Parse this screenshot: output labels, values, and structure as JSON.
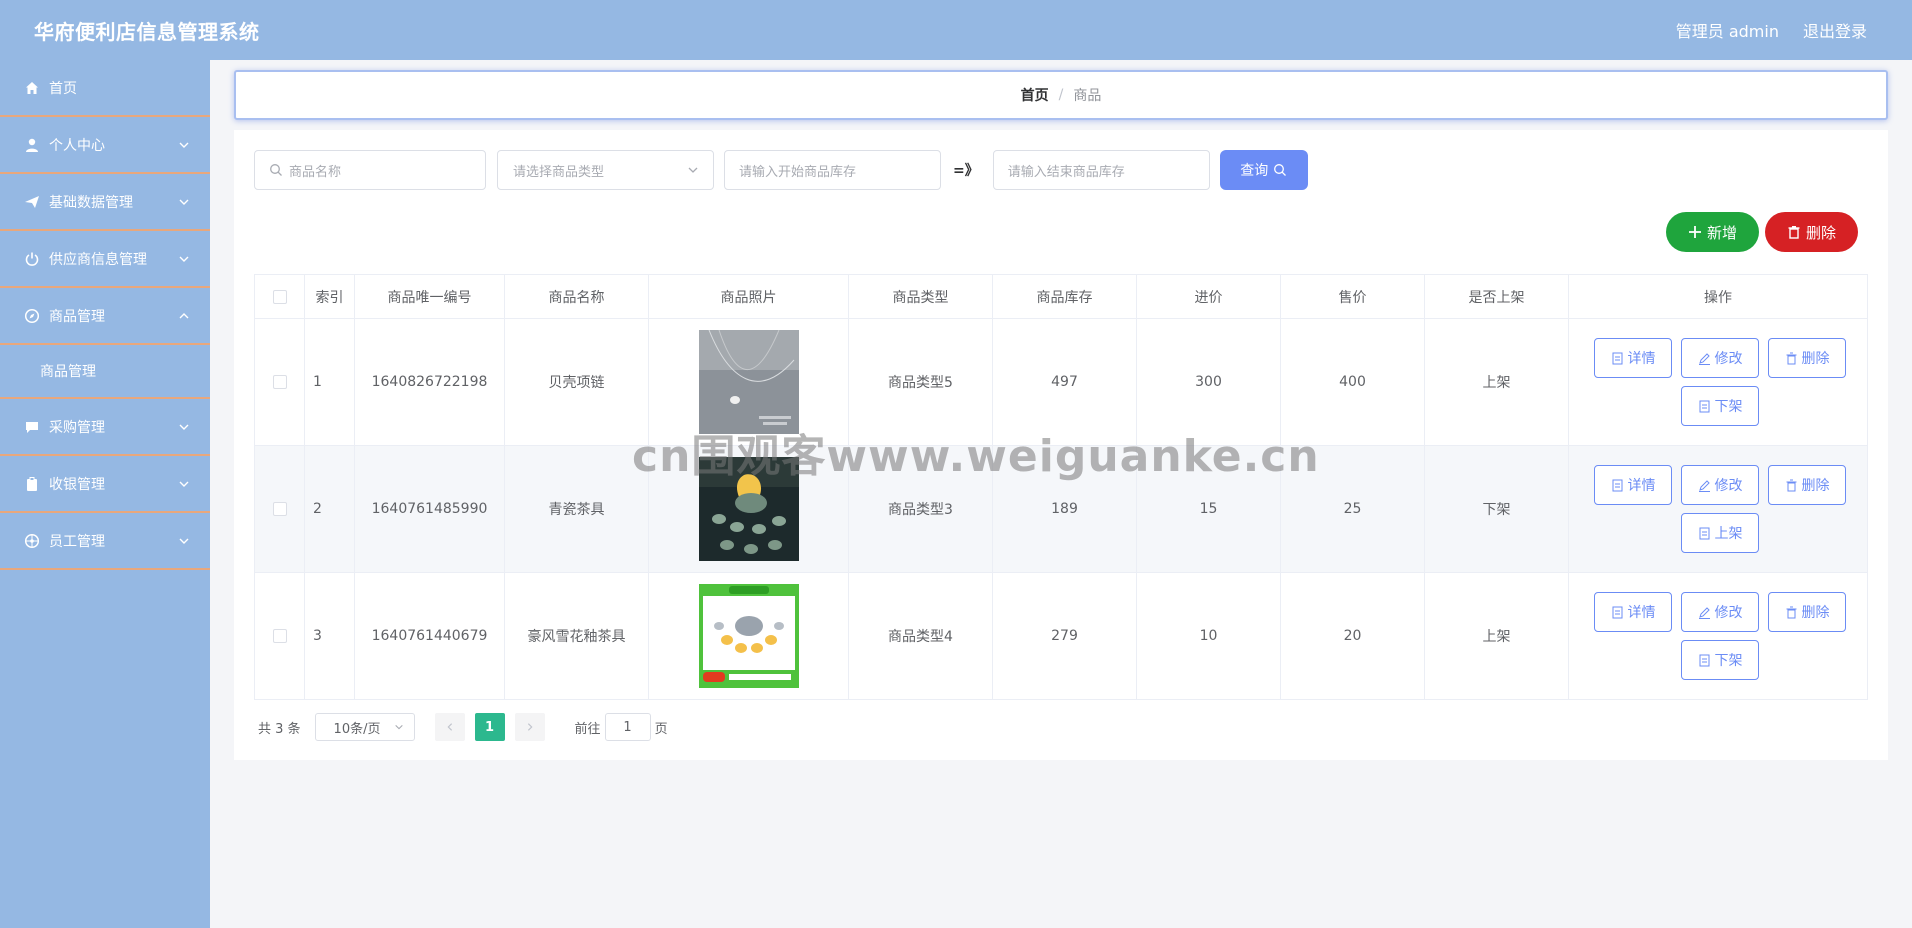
{
  "header": {
    "title": "华府便利店信息管理系统",
    "admin_label": "管理员 admin",
    "logout_label": "退出登录"
  },
  "sidebar": {
    "items": [
      {
        "label": "首页",
        "icon": "home-icon"
      },
      {
        "label": "个人中心",
        "icon": "user-icon"
      },
      {
        "label": "基础数据管理",
        "icon": "send-icon"
      },
      {
        "label": "供应商信息管理",
        "icon": "power-icon"
      },
      {
        "label": "商品管理",
        "icon": "compass-icon"
      },
      {
        "label": "采购管理",
        "icon": "chat-icon"
      },
      {
        "label": "收银管理",
        "icon": "clipboard-icon"
      },
      {
        "label": "员工管理",
        "icon": "wheel-icon"
      }
    ],
    "sub_item": "商品管理"
  },
  "breadcrumb": {
    "home": "首页",
    "separator": "/",
    "current": "商品"
  },
  "search": {
    "name_placeholder": "商品名称",
    "type_placeholder": "请选择商品类型",
    "stock_start_placeholder": "请输入开始商品库存",
    "range_symbol": "=》",
    "stock_end_placeholder": "请输入结束商品库存",
    "query_label": "查询"
  },
  "actions": {
    "add_label": "新增",
    "delete_label": "删除"
  },
  "table": {
    "headers": [
      "索引",
      "商品唯一编号",
      "商品名称",
      "商品照片",
      "商品类型",
      "商品库存",
      "进价",
      "售价",
      "是否上架",
      "操作"
    ],
    "rows": [
      {
        "index": "1",
        "code": "1640826722198",
        "name": "贝壳项链",
        "type": "商品类型5",
        "stock": "497",
        "cost": "300",
        "price": "400",
        "status": "上架",
        "toggle": "下架"
      },
      {
        "index": "2",
        "code": "1640761485990",
        "name": "青瓷茶具",
        "type": "商品类型3",
        "stock": "189",
        "cost": "15",
        "price": "25",
        "status": "下架",
        "toggle": "上架"
      },
      {
        "index": "3",
        "code": "1640761440679",
        "name": "豪风雪花釉茶具",
        "type": "商品类型4",
        "stock": "279",
        "cost": "10",
        "price": "20",
        "status": "上架",
        "toggle": "下架"
      }
    ],
    "op_labels": {
      "detail": "详情",
      "edit": "修改",
      "delete": "删除"
    }
  },
  "pagination": {
    "total": "共 3 条",
    "page_size": "10条/页",
    "current_page": "1",
    "goto_label": "前往",
    "goto_value": "1",
    "page_suffix": "页"
  },
  "watermark": "cn围观客www.weiguanke.cn",
  "colors": {
    "header_bg": "#95b8e3",
    "primary": "#6b8cf5",
    "add_green": "#1fa53d",
    "delete_red": "#d62124",
    "pager_active": "#2cb88e"
  }
}
